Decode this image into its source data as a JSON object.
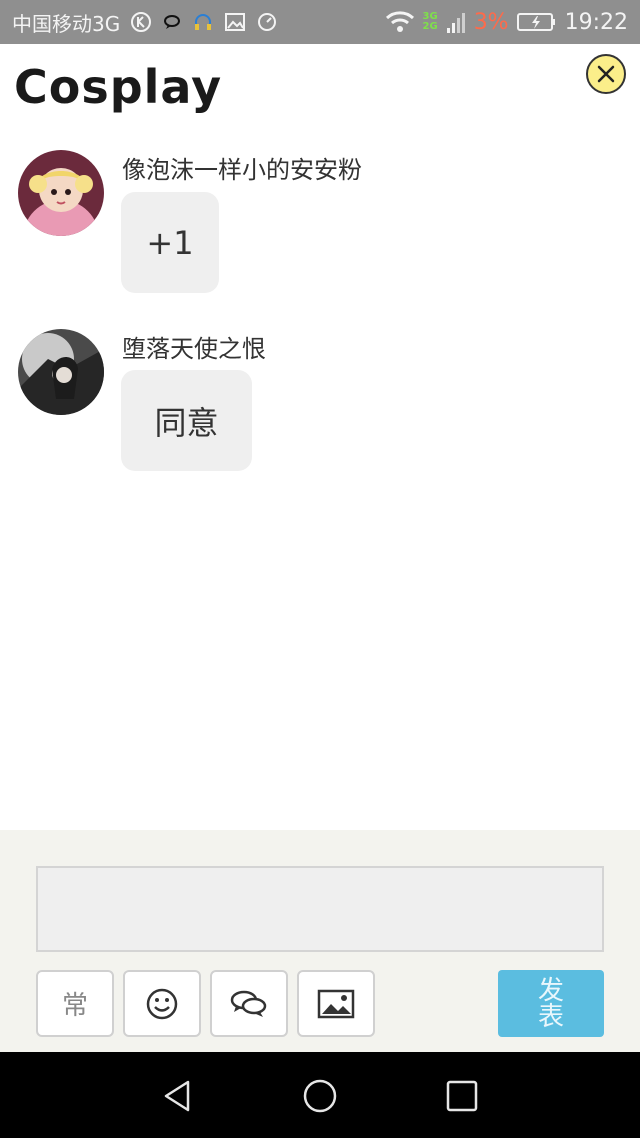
{
  "status_bar": {
    "carrier": "中国移动3G",
    "net_top": "3G",
    "net_bottom": "2G",
    "battery_percent": "3%",
    "time": "19:22"
  },
  "header": {
    "title": "Cosplay"
  },
  "messages": [
    {
      "sender": "像泡沫一样小的安安粉",
      "text": "+1"
    },
    {
      "sender": "堕落天使之恨",
      "text": "同意"
    }
  ],
  "composer": {
    "input_value": "",
    "send_label": "发表",
    "tools": [
      "common-phrases-icon",
      "emoji-icon",
      "chat-icon",
      "image-icon"
    ],
    "tool_glyph_common": "常"
  },
  "colors": {
    "accent": "#5bbde0",
    "close_bg": "#fbee8a",
    "bubble_bg": "#efefef",
    "status_bar_bg": "#8f8f8f"
  }
}
